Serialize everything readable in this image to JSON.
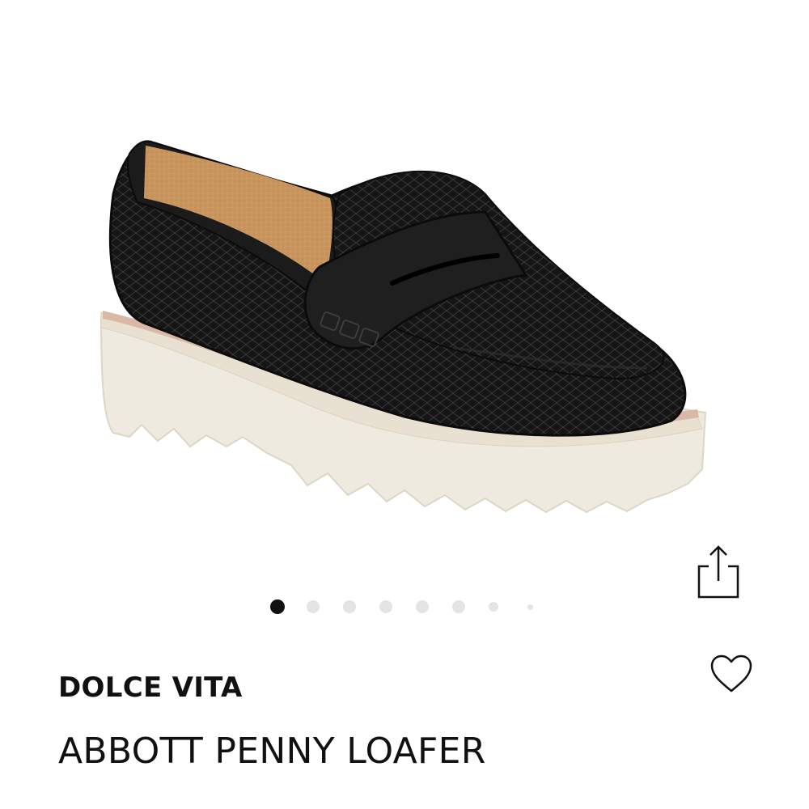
{
  "product": {
    "brand": "DOLCE VITA",
    "name": "ABBOTT PENNY LOAFER",
    "image_alt": "black snake-embossed penny loafer with white lug sole"
  },
  "gallery": {
    "total_images": 8,
    "active_index": 0
  },
  "actions": {
    "share_icon": "share-icon",
    "favorite_icon": "heart-outline-icon"
  },
  "colors": {
    "text": "#111111",
    "dot_active": "#111111",
    "dot_inactive": "#e4e4e4",
    "leather": "#141414",
    "sole": "#efeadf",
    "welt": "#d9b8a6",
    "lining": "#c9955e"
  }
}
